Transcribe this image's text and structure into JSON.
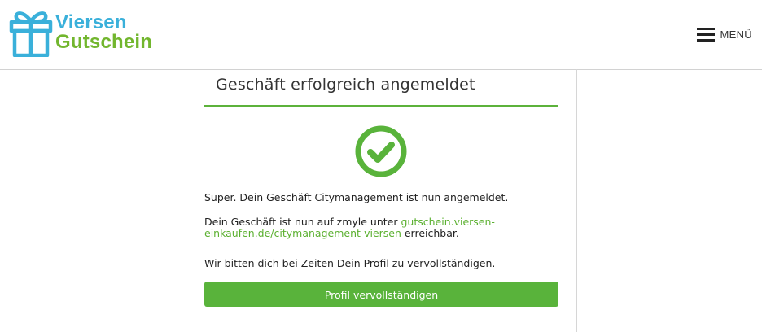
{
  "header": {
    "logo_line1": "Viersen",
    "logo_line2": "Gutschein",
    "menu_label": "MENÜ"
  },
  "card": {
    "title": "Geschäft erfolgreich angemeldet",
    "success_text": "Super. Dein Geschäft Citymanagement ist nun angemeldet.",
    "url_prefix": "Dein Geschäft ist nun auf zmyle unter ",
    "url_link": "gutschein.viersen-einkaufen.de/citymanagement-viersen",
    "url_suffix": " erreichbar.",
    "profile_hint": "Wir bitten dich bei Zeiten Dein Profil zu vervollständigen.",
    "button_label": "Profil vervollständigen"
  },
  "colors": {
    "brand_blue": "#3ab0da",
    "brand_green": "#72b62e",
    "accent_green": "#59b33b"
  },
  "icons": [
    "gift-logo-icon",
    "hamburger-icon",
    "check-circle-icon"
  ]
}
